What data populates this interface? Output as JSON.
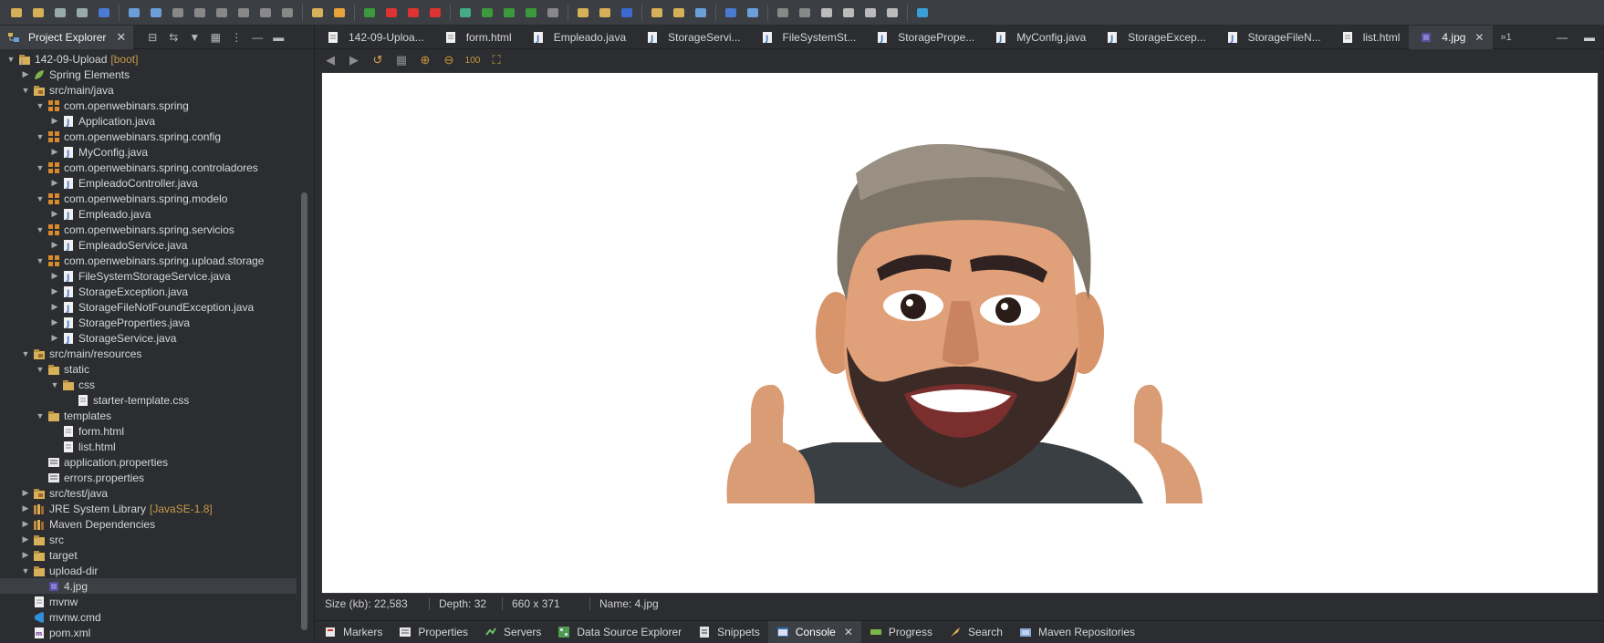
{
  "explorer": {
    "title": "Project Explorer",
    "tree": [
      {
        "label": "142-09-Upload",
        "deco": "[boot]",
        "indent": 0,
        "icon": "project",
        "expanded": true
      },
      {
        "label": "Spring Elements",
        "indent": 1,
        "icon": "spring",
        "expanded": false
      },
      {
        "label": "src/main/java",
        "indent": 1,
        "icon": "srcfolder",
        "expanded": true
      },
      {
        "label": "com.openwebinars.spring",
        "indent": 2,
        "icon": "package",
        "expanded": true
      },
      {
        "label": "Application.java",
        "indent": 3,
        "icon": "java",
        "expanded": false
      },
      {
        "label": "com.openwebinars.spring.config",
        "indent": 2,
        "icon": "package",
        "expanded": true
      },
      {
        "label": "MyConfig.java",
        "indent": 3,
        "icon": "java",
        "expanded": false
      },
      {
        "label": "com.openwebinars.spring.controladores",
        "indent": 2,
        "icon": "package",
        "expanded": true
      },
      {
        "label": "EmpleadoController.java",
        "indent": 3,
        "icon": "java",
        "expanded": false
      },
      {
        "label": "com.openwebinars.spring.modelo",
        "indent": 2,
        "icon": "package",
        "expanded": true
      },
      {
        "label": "Empleado.java",
        "indent": 3,
        "icon": "java",
        "expanded": false
      },
      {
        "label": "com.openwebinars.spring.servicios",
        "indent": 2,
        "icon": "package",
        "expanded": true
      },
      {
        "label": "EmpleadoService.java",
        "indent": 3,
        "icon": "java",
        "expanded": false
      },
      {
        "label": "com.openwebinars.spring.upload.storage",
        "indent": 2,
        "icon": "package",
        "expanded": true
      },
      {
        "label": "FileSystemStorageService.java",
        "indent": 3,
        "icon": "java",
        "expanded": false
      },
      {
        "label": "StorageException.java",
        "indent": 3,
        "icon": "java",
        "expanded": false
      },
      {
        "label": "StorageFileNotFoundException.java",
        "indent": 3,
        "icon": "java",
        "expanded": false
      },
      {
        "label": "StorageProperties.java",
        "indent": 3,
        "icon": "java",
        "expanded": false
      },
      {
        "label": "StorageService.java",
        "indent": 3,
        "icon": "java",
        "expanded": false
      },
      {
        "label": "src/main/resources",
        "indent": 1,
        "icon": "srcfolder",
        "expanded": true
      },
      {
        "label": "static",
        "indent": 2,
        "icon": "folder",
        "expanded": true
      },
      {
        "label": "css",
        "indent": 3,
        "icon": "folder",
        "expanded": true
      },
      {
        "label": "starter-template.css",
        "indent": 4,
        "icon": "file",
        "leaf": true
      },
      {
        "label": "templates",
        "indent": 2,
        "icon": "folder",
        "expanded": true
      },
      {
        "label": "form.html",
        "indent": 3,
        "icon": "file",
        "leaf": true
      },
      {
        "label": "list.html",
        "indent": 3,
        "icon": "file",
        "leaf": true
      },
      {
        "label": "application.properties",
        "indent": 2,
        "icon": "props",
        "leaf": true
      },
      {
        "label": "errors.properties",
        "indent": 2,
        "icon": "props",
        "leaf": true
      },
      {
        "label": "src/test/java",
        "indent": 1,
        "icon": "srcfolder",
        "expanded": false
      },
      {
        "label": "JRE System Library",
        "deco": "[JavaSE-1.8]",
        "indent": 1,
        "icon": "library",
        "expanded": false
      },
      {
        "label": "Maven Dependencies",
        "indent": 1,
        "icon": "library",
        "expanded": false
      },
      {
        "label": "src",
        "indent": 1,
        "icon": "folder",
        "expanded": false
      },
      {
        "label": "target",
        "indent": 1,
        "icon": "folder",
        "expanded": false
      },
      {
        "label": "upload-dir",
        "indent": 1,
        "icon": "folder",
        "expanded": true
      },
      {
        "label": "4.jpg",
        "indent": 2,
        "icon": "image",
        "leaf": true,
        "selected": true
      },
      {
        "label": "mvnw",
        "indent": 1,
        "icon": "file",
        "leaf": true
      },
      {
        "label": "mvnw.cmd",
        "indent": 1,
        "icon": "vscode",
        "leaf": true
      },
      {
        "label": "pom.xml",
        "indent": 1,
        "icon": "xml",
        "leaf": true
      }
    ]
  },
  "editor_tabs": [
    {
      "label": "142-09-Uploa...",
      "icon": "file"
    },
    {
      "label": "form.html",
      "icon": "file"
    },
    {
      "label": "Empleado.java",
      "icon": "java"
    },
    {
      "label": "StorageServi...",
      "icon": "java"
    },
    {
      "label": "FileSystemSt...",
      "icon": "java"
    },
    {
      "label": "StoragePrope...",
      "icon": "java"
    },
    {
      "label": "MyConfig.java",
      "icon": "java"
    },
    {
      "label": "StorageExcep...",
      "icon": "java"
    },
    {
      "label": "StorageFileN...",
      "icon": "java"
    },
    {
      "label": "list.html",
      "icon": "file"
    },
    {
      "label": "4.jpg",
      "icon": "image",
      "active": true
    }
  ],
  "editor_more": "»1",
  "status": {
    "size": "Size (kb): 22,583",
    "depth": "Depth: 32",
    "dims": "660 x 371",
    "name": "Name: 4.jpg"
  },
  "bottom_tabs": [
    {
      "label": "Markers",
      "icon": "markers"
    },
    {
      "label": "Properties",
      "icon": "properties"
    },
    {
      "label": "Servers",
      "icon": "servers"
    },
    {
      "label": "Data Source Explorer",
      "icon": "datasource"
    },
    {
      "label": "Snippets",
      "icon": "snippets"
    },
    {
      "label": "Console",
      "icon": "console",
      "active": true
    },
    {
      "label": "Progress",
      "icon": "progress"
    },
    {
      "label": "Search",
      "icon": "search"
    },
    {
      "label": "Maven Repositories",
      "icon": "maven"
    }
  ],
  "colors": {
    "accent_orange": "#e8a33a",
    "java_blue": "#6a9fd4",
    "package_orange": "#d98a2b",
    "folder_yellow": "#d7b05a"
  }
}
